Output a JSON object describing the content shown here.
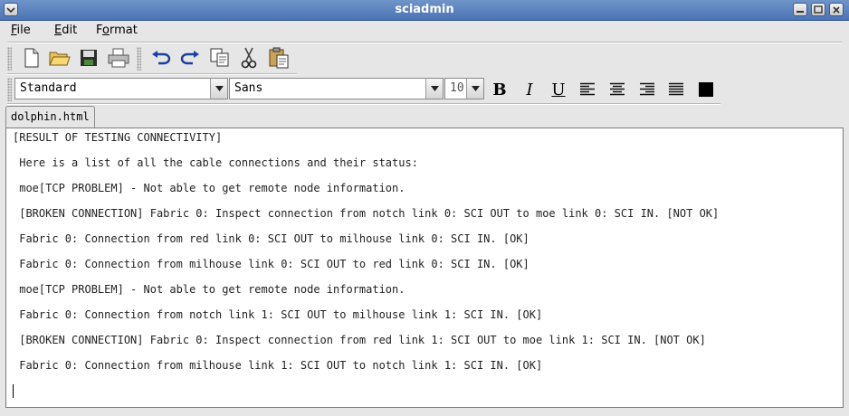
{
  "window": {
    "title": "sciadmin"
  },
  "menubar": {
    "items": [
      {
        "accel": "F",
        "rest": "ile"
      },
      {
        "accel": "E",
        "rest": "dit"
      },
      {
        "pre": "F",
        "accel": "o",
        "rest": "rmat"
      }
    ]
  },
  "toolbar": {
    "icons": [
      "new-document-icon",
      "open-folder-icon",
      "save-disk-icon",
      "print-icon",
      "undo-icon",
      "redo-icon",
      "copy-icon",
      "cut-icon",
      "paste-icon"
    ]
  },
  "format_bar": {
    "style_value": "Standard",
    "font_value": "Sans",
    "size_value": "10",
    "bold_label": "B",
    "italic_label": "I",
    "underline_label": "U",
    "color_value": "#000000"
  },
  "tabs": [
    {
      "label": "dolphin.html"
    }
  ],
  "document": {
    "lines": [
      "[RESULT OF TESTING CONNECTIVITY]",
      " Here is a list of all the cable connections and their status:",
      " moe[TCP PROBLEM] - Not able to get remote node information.",
      " [BROKEN CONNECTION] Fabric 0: Inspect connection from notch link 0: SCI OUT to moe link 0: SCI IN. [NOT OK]",
      " Fabric 0: Connection from red link 0: SCI OUT to milhouse link 0: SCI IN. [OK]",
      " Fabric 0: Connection from milhouse link 0: SCI OUT to red link 0: SCI IN. [OK]",
      " moe[TCP PROBLEM] - Not able to get remote node information.",
      " Fabric 0: Connection from notch link 1: SCI OUT to milhouse link 1: SCI IN. [OK]",
      " [BROKEN CONNECTION] Fabric 0: Inspect connection from red link 1: SCI OUT to moe link 1: SCI IN. [NOT OK]",
      " Fabric 0: Connection from milhouse link 1: SCI OUT to notch link 1: SCI IN. [OK]"
    ]
  }
}
